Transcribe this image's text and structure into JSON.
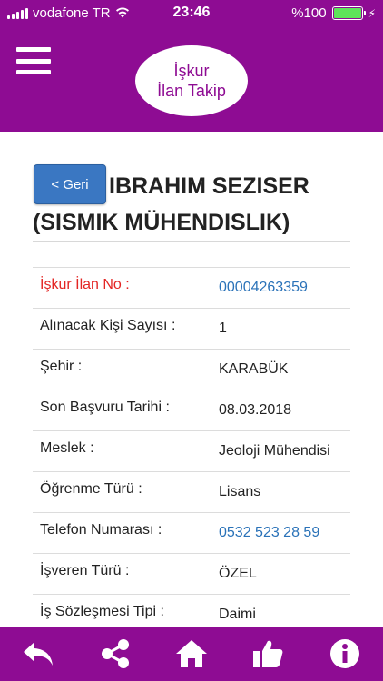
{
  "status": {
    "carrier": "vodafone TR",
    "time": "23:46",
    "battery": "%100",
    "battery_level": 1.0
  },
  "header": {
    "logo_line1": "İşkur",
    "logo_line2": "İlan Takip"
  },
  "back_label": "< Geri",
  "title": "IBRAHIM SEZISER (SISMIK MÜHENDISLIK)",
  "details": [
    {
      "label": "İşkur İlan No :",
      "value": "00004263359"
    },
    {
      "label": "Alınacak Kişi Sayısı :",
      "value": "1"
    },
    {
      "label": "Şehir :",
      "value": "KARABÜK"
    },
    {
      "label": "Son Başvuru Tarihi :",
      "value": "08.03.2018"
    },
    {
      "label": "Meslek :",
      "value": "Jeoloji Mühendisi"
    },
    {
      "label": "Öğrenme Türü :",
      "value": "Lisans"
    },
    {
      "label": "Telefon Numarası :",
      "value": "0532 523 28 59"
    },
    {
      "label": "İşveren Türü :",
      "value": "ÖZEL"
    },
    {
      "label": "İş Sözleşmesi Tipi :",
      "value": "Daimi"
    }
  ],
  "bottom_nav": [
    "back-arrow-icon",
    "share-icon",
    "home-icon",
    "thumbs-up-icon",
    "info-icon"
  ],
  "colors": {
    "primary": "#8e0c93",
    "button": "#3a77c2",
    "label_red": "#e32624",
    "link_blue": "#2a72b8"
  }
}
